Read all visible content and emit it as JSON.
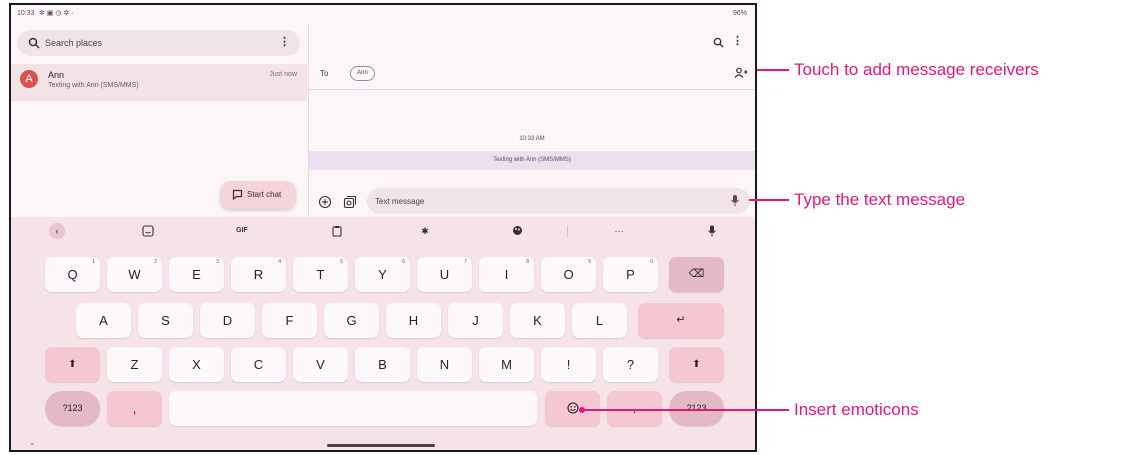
{
  "status": {
    "time": "10:33",
    "right": "96%"
  },
  "search": {
    "placeholder": "Search places",
    "menu": "⋮"
  },
  "conversation": {
    "avatar_letter": "A",
    "name": "Ann",
    "subtitle": "Texting with Ann (SMS/MMS)",
    "time": "Just now"
  },
  "start_chat": {
    "label": "Start chat"
  },
  "message": {
    "menu": "⋮",
    "to_label": "To",
    "chip": "Ann",
    "timestamp": "10:33 AM",
    "system_message": "Texting with Ann (SMS/MMS)",
    "compose_placeholder": "Text message"
  },
  "keyboard": {
    "toolbar": {
      "gif": "GIF",
      "more": "···"
    },
    "row1": [
      {
        "k": "Q",
        "h": "1"
      },
      {
        "k": "W",
        "h": "2"
      },
      {
        "k": "E",
        "h": "3"
      },
      {
        "k": "R",
        "h": "4"
      },
      {
        "k": "T",
        "h": "5"
      },
      {
        "k": "Y",
        "h": "6"
      },
      {
        "k": "U",
        "h": "7"
      },
      {
        "k": "I",
        "h": "8"
      },
      {
        "k": "O",
        "h": "9"
      },
      {
        "k": "P",
        "h": "0"
      }
    ],
    "row2": [
      "A",
      "S",
      "D",
      "F",
      "G",
      "H",
      "J",
      "K",
      "L"
    ],
    "row3": [
      "Z",
      "X",
      "C",
      "V",
      "B",
      "N",
      "M",
      "!",
      "?"
    ],
    "backspace": "⌫",
    "enter": "↵",
    "shift": "⬆",
    "sym": "?123",
    "comma": ",",
    "period": ".",
    "sym_right": "?123"
  },
  "callouts": {
    "add_receivers": "Touch to add message receivers",
    "type_text": "Type the text message",
    "emoticons": "Insert emoticons"
  },
  "colors": {
    "accent": "#e0197d",
    "keyboard_bg": "#f6e3e7",
    "pink_key": "#f5c7d2"
  }
}
